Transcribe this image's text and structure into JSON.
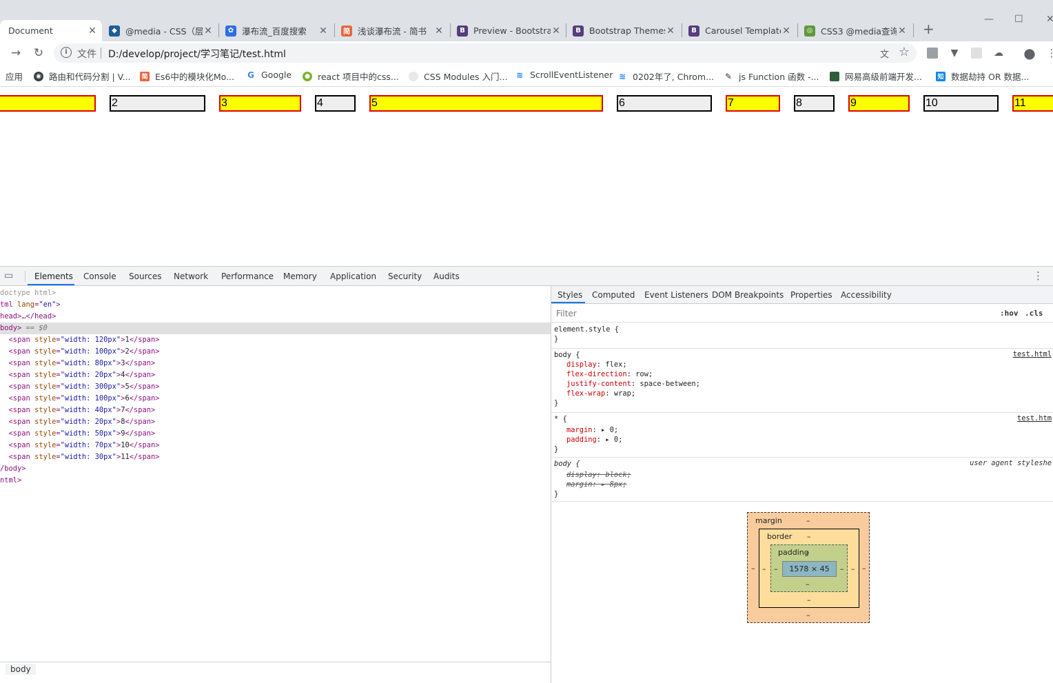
{
  "tabs": [
    {
      "title": "Document",
      "favicon": "document-icon",
      "active": true
    },
    {
      "title": "@media - CSS（层",
      "favicon": "mdn-icon"
    },
    {
      "title": "瀑布流_百度搜索",
      "favicon": "baidu-paw-icon"
    },
    {
      "title": "浅谈瀑布流 - 简书",
      "favicon": "jianshu-icon",
      "badge": "简"
    },
    {
      "title": "Preview - Bootstra",
      "favicon": "bootstrap-icon",
      "badge": "B"
    },
    {
      "title": "Bootstrap Themes",
      "favicon": "bootstrap-icon",
      "badge": "B"
    },
    {
      "title": "Carousel Template",
      "favicon": "bootstrap-icon",
      "badge": "B"
    },
    {
      "title": "CSS3 @media查询",
      "favicon": "runoob-icon"
    }
  ],
  "toolbar": {
    "scheme": "文件",
    "url": "D:/develop/project/学习笔记/test.html"
  },
  "bookmarks": [
    {
      "label": "应用",
      "icon": "apps-icon"
    },
    {
      "label": "路由和代码分割 | V...",
      "icon": "globe-icon"
    },
    {
      "label": "Es6中的模块化Mo...",
      "icon": "jianshu-icon",
      "badge": "简"
    },
    {
      "label": "Google",
      "icon": "google-icon",
      "badge": "G"
    },
    {
      "label": "react 项目中的css...",
      "icon": "wechat-icon"
    },
    {
      "label": "CSS Modules 入门...",
      "icon": "egg-icon"
    },
    {
      "label": "ScrollEventListener",
      "icon": "chevron-logo-icon"
    },
    {
      "label": "0202年了, Chrom...",
      "icon": "chevron-logo-icon"
    },
    {
      "label": "js Function 函数 -...",
      "icon": "pen-logo-icon"
    },
    {
      "label": "网易高级前端开发...",
      "icon": "book-icon"
    },
    {
      "label": "数据劫持 OR 数据...",
      "icon": "zhihu-icon",
      "badge": "知"
    }
  ],
  "page": {
    "spans": [
      "",
      "2",
      "3",
      "4",
      "5",
      "6",
      "7",
      "8",
      "9",
      "10",
      "11"
    ]
  },
  "devtools": {
    "tabs": [
      "Elements",
      "Console",
      "Sources",
      "Network",
      "Performance",
      "Memory",
      "Application",
      "Security",
      "Audits"
    ],
    "elements": {
      "doctype": "doctype html>",
      "html_open_tag": "tml ",
      "html_attr": "lang",
      "html_val": "\"en\"",
      "head": "head>…</head>",
      "body": "body>",
      "body_eq": " == $0",
      "spans": [
        {
          "width": "\"width: 120px\"",
          "text": "1"
        },
        {
          "width": "\"width: 100px\"",
          "text": "2"
        },
        {
          "width": "\"width: 80px\"",
          "text": "3"
        },
        {
          "width": "\"width: 20px\"",
          "text": "4"
        },
        {
          "width": "\"width: 300px\"",
          "text": "5"
        },
        {
          "width": "\"width: 100px\"",
          "text": "6"
        },
        {
          "width": "\"width: 40px\"",
          "text": "7"
        },
        {
          "width": "\"width: 20px\"",
          "text": "8"
        },
        {
          "width": "\"width: 50px\"",
          "text": "9"
        },
        {
          "width": "\"width: 70px\"",
          "text": "10"
        },
        {
          "width": "\"width: 30px\"",
          "text": "11"
        }
      ],
      "body_close": "/body>",
      "html_close": "ntml>"
    },
    "breadcrumb": "body",
    "styles": {
      "subtabs": [
        "Styles",
        "Computed",
        "Event Listeners",
        "DOM Breakpoints",
        "Properties",
        "Accessibility"
      ],
      "filter_placeholder": "Filter",
      "hov": ":hov",
      "cls": ".cls",
      "element_style": "element.style {",
      "close_brace": "}",
      "rule1_selector": "body {",
      "rule1_source": "test.html",
      "rule1_props": [
        {
          "name": "display",
          "value": "flex;"
        },
        {
          "name": "flex-direction",
          "value": "row;"
        },
        {
          "name": "justify-content",
          "value": "space-between;"
        },
        {
          "name": "flex-wrap",
          "value": "wrap;"
        }
      ],
      "rule2_selector": "* {",
      "rule2_source": "test.htm",
      "rule2_props": [
        {
          "name": "margin",
          "value": "0;"
        },
        {
          "name": "padding",
          "value": "0;"
        }
      ],
      "rule3_selector": "body {",
      "rule3_source": "user agent styleshe",
      "rule3_props": [
        {
          "name": "display",
          "value": "block;"
        },
        {
          "name": "margin",
          "value": "8px;"
        }
      ]
    },
    "boxmodel": {
      "margin": "margin",
      "border": "border",
      "padding": "padding",
      "content": "1578 × 45",
      "dash": "–"
    }
  },
  "colors": {
    "odd_fill": "#ffff00",
    "odd_border": "#e00000",
    "even_fill": "#eeeeee",
    "accent": "#1a73e8"
  }
}
